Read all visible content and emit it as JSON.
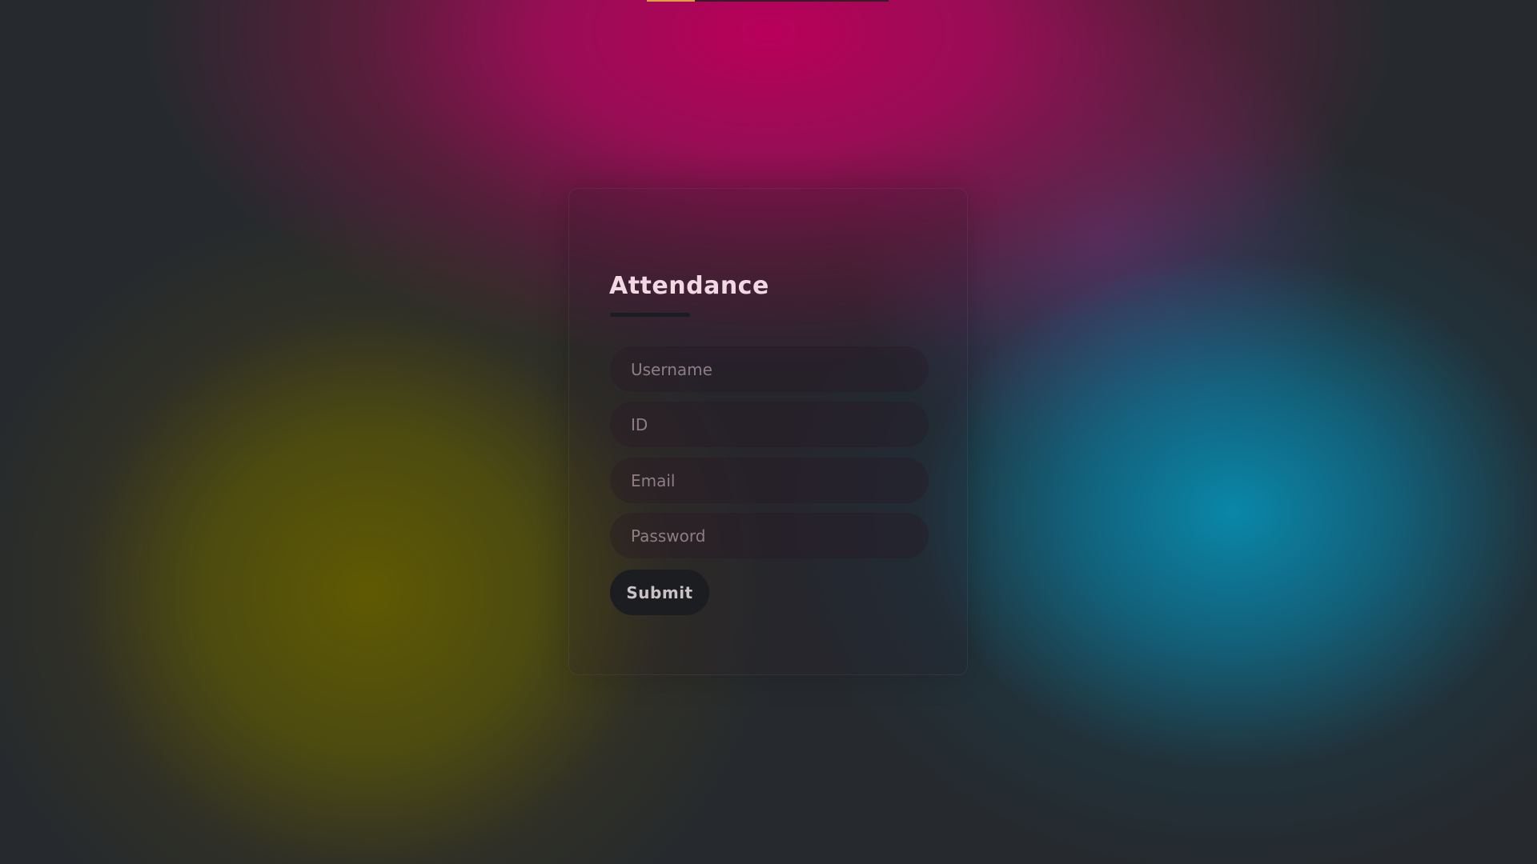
{
  "form": {
    "title": "Attendance",
    "fields": [
      {
        "name": "username",
        "placeholder": "Username",
        "value": ""
      },
      {
        "name": "id",
        "placeholder": "ID",
        "value": ""
      },
      {
        "name": "email",
        "placeholder": "Email",
        "value": ""
      },
      {
        "name": "password",
        "placeholder": "Password",
        "value": ""
      }
    ],
    "submit_label": "Submit"
  },
  "colors": {
    "background": "#262a2e",
    "magenta_glow": "#b8005a",
    "cyan_glow": "#0a8cae",
    "olive_glow": "#5c5800",
    "button": "#1c1d21",
    "title_text": "#f1d8e2"
  }
}
